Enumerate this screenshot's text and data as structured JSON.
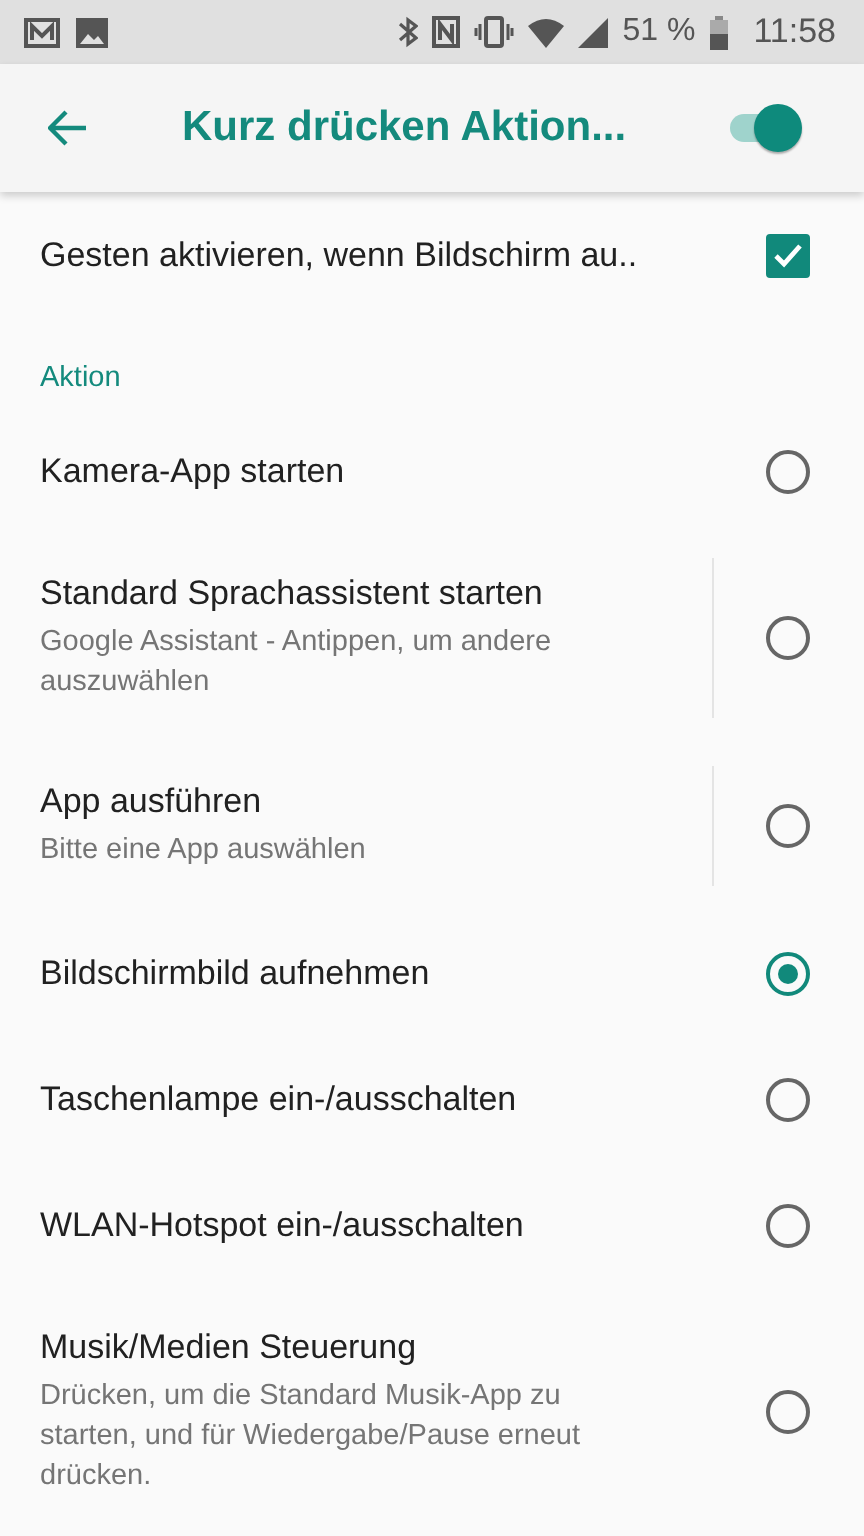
{
  "status_bar": {
    "battery": "51 %",
    "time": "11:58"
  },
  "app_bar": {
    "title": "Kurz drücken Aktion...",
    "switch_on": true
  },
  "gesture_setting": {
    "label": "Gesten aktivieren, wenn Bildschirm au..",
    "checked": true
  },
  "section": {
    "title": "Aktion"
  },
  "options": [
    {
      "kind": "plain",
      "title": "Kamera-App starten",
      "selected": false
    },
    {
      "kind": "split",
      "title": "Standard Sprachassistent starten",
      "subtitle": "Google Assistant - Antippen, um andere auszuwählen",
      "selected": false
    },
    {
      "kind": "split",
      "title": "App ausführen",
      "subtitle": "Bitte eine App auswählen",
      "selected": false
    },
    {
      "kind": "plain",
      "title": "Bildschirmbild aufnehmen",
      "selected": true
    },
    {
      "kind": "plain",
      "title": "Taschenlampe ein-/ausschalten",
      "selected": false
    },
    {
      "kind": "plain",
      "title": "WLAN-Hotspot ein-/ausschalten",
      "selected": false
    },
    {
      "kind": "plain",
      "title": "Musik/Medien Steuerung",
      "subtitle": "Drücken, um die Standard Musik-App zu starten, und für Wiedergabe/Pause erneut drücken.",
      "selected": false
    }
  ]
}
